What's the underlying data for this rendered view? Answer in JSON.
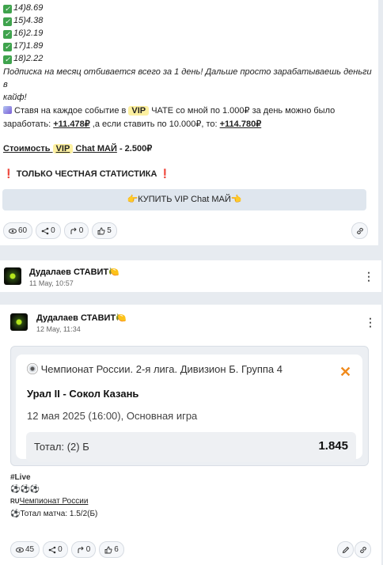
{
  "post1": {
    "results": [
      {
        "mark": "✓",
        "text": "14)8.69"
      },
      {
        "mark": "✓",
        "text": "15)4.38"
      },
      {
        "mark": "✓",
        "text": "16)2.19"
      },
      {
        "mark": "✓",
        "text": "17)1.89"
      },
      {
        "mark": "✓",
        "text": "18)2.22"
      }
    ],
    "subscribe_text_1": "Подписка на месяц отбивается всего за 1 день! Дальше просто зарабатываешь деньги в",
    "subscribe_text_2": "кайф!",
    "bet_line_a": "Ставя на каждое событие в ",
    "vip": "VIP",
    "bet_line_b": " ЧАТЕ со мной по 1.000₽ за день можно было",
    "earn_a": "заработать: ",
    "earn_1": "+11.478₽",
    "earn_b": " ,а если ставить по 10.000₽, то: ",
    "earn_2": "+114.780₽",
    "price_label": "Стоимость",
    "price_chat": " Chat МАЙ",
    "price_value": " - 2.500₽",
    "honest_stats": " ТОЛЬКО ЧЕСТНАЯ СТАТИСТИКА ",
    "bang": "❗",
    "buy_button": "КУПИТЬ VIP Chat МАЙ",
    "hand_left": "👉",
    "hand_right": "👈",
    "views": "60",
    "shares": "0",
    "forwards": "0",
    "likes": "5"
  },
  "post2_header": {
    "author": "Дудалаев СТАВИТ",
    "author_emoji": "🍋",
    "time": "11 May, 10:57"
  },
  "post3": {
    "author": "Дудалаев СТАВИТ",
    "author_emoji": "🍋",
    "time": "12 May, 11:34",
    "bet_card": {
      "league": "Чемпионат России. 2-я лига. Дивизион Б. Группа 4",
      "close": "✕",
      "match": "Урал II - Сокол Казань",
      "date": "12 мая 2025 (16:00), Основная игра",
      "bet_label": "Тотал: (2) Б",
      "odds": "1.845"
    },
    "tag": "#Live",
    "ball_row": "⚽⚽⚽",
    "flag": "RU",
    "championship": "Чемпионат России",
    "total_ball": "⚽",
    "total_text": "Тотал матча: 1.5/2(Б)",
    "views": "45",
    "shares": "0",
    "forwards": "0",
    "likes": "6"
  },
  "colors": {
    "accent_green": "#3fa34d",
    "vip_highlight": "#fdf0a0",
    "close_orange": "#f08a1c",
    "warning_red": "#e53935"
  }
}
